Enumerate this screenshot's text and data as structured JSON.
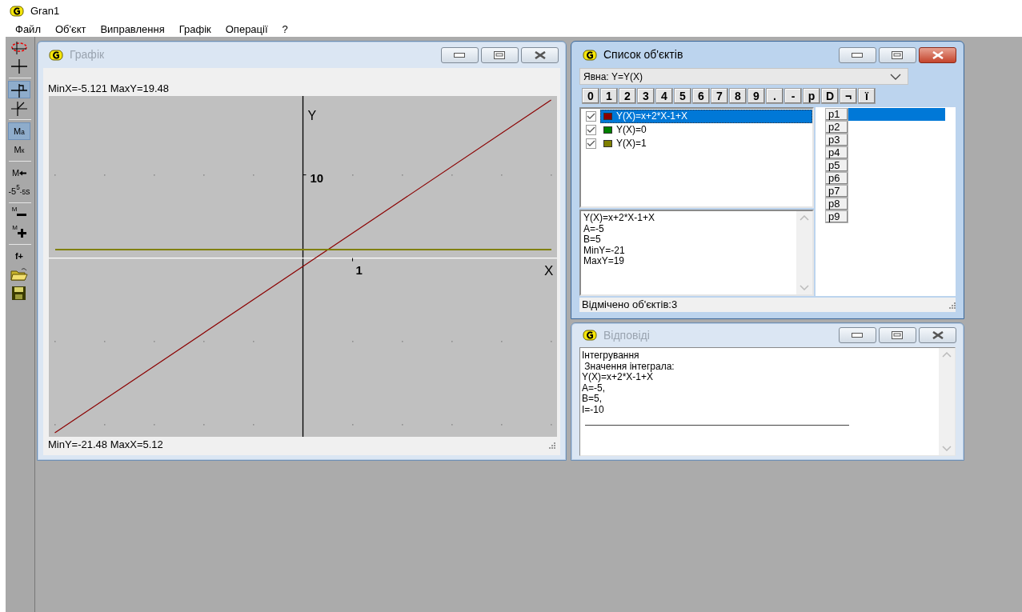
{
  "app": {
    "title": "Gran1"
  },
  "menu": [
    "Файл",
    "Об'єкт",
    "Виправлення",
    "Графік",
    "Операції",
    "?"
  ],
  "toolbar": [
    [
      {
        "kind": "ellipse-cross",
        "selected": false
      },
      {
        "kind": "cross",
        "selected": false
      }
    ],
    [
      {
        "kind": "cross-flag",
        "selected": true
      },
      {
        "kind": "cross-slant",
        "selected": false
      }
    ],
    [
      {
        "kind": "text",
        "label": "M$_{a}$",
        "selected": true
      },
      {
        "kind": "text",
        "label": "M$_{к}$",
        "selected": false
      }
    ],
    [
      {
        "kind": "text-arrow",
        "label": "M",
        "selected": false
      },
      {
        "kind": "text",
        "label": "-5$^{5}$$_{-5}$s",
        "selected": false
      }
    ],
    [
      {
        "kind": "text-minus",
        "label": "M",
        "selected": false
      },
      {
        "kind": "text-plus",
        "label": "M",
        "selected": false
      }
    ],
    [
      {
        "kind": "text",
        "label": "f+",
        "selected": false
      },
      {
        "kind": "folder",
        "selected": false
      },
      {
        "kind": "disk",
        "selected": false
      }
    ]
  ],
  "graph_window": {
    "title": "Графік",
    "active": false,
    "top_label": "MinX=-5.121  MaxY=19.48",
    "bottom_label": "MinY=-21.48  MaxX=5.12",
    "plot": {
      "x_axis_label": "X",
      "y_axis_label": "Y",
      "y_tick_label": "10",
      "x_tick_label": "1",
      "lines": [
        {
          "kind": "rising",
          "color": "#8b0000"
        },
        {
          "kind": "flat",
          "color": "#808000"
        }
      ]
    }
  },
  "objects_window": {
    "title": "Список об'єктів",
    "active": true,
    "type_select": "Явна: Y=Y(X)",
    "keys": [
      "0",
      "1",
      "2",
      "3",
      "4",
      "5",
      "6",
      "7",
      "8",
      "9",
      ".",
      "-",
      "p",
      "D",
      "¬",
      "ї"
    ],
    "objects": [
      {
        "text": "Y(X)=x+2*X-1+X",
        "checked": true,
        "color": "#8b0000",
        "selected": true
      },
      {
        "text": "Y(X)=0",
        "checked": true,
        "color": "#008000",
        "selected": false
      },
      {
        "text": "Y(X)=1",
        "checked": true,
        "color": "#808000",
        "selected": false
      }
    ],
    "details": [
      "Y(X)=x+2*X-1+X",
      "A=-5",
      "B=5",
      "MinY=-21",
      "MaxY=19"
    ],
    "params": [
      {
        "label": "p1",
        "selected": true
      },
      {
        "label": "p2",
        "selected": false
      },
      {
        "label": "p3",
        "selected": false
      },
      {
        "label": "p4",
        "selected": false
      },
      {
        "label": "p5",
        "selected": false
      },
      {
        "label": "p6",
        "selected": false
      },
      {
        "label": "p7",
        "selected": false
      },
      {
        "label": "p8",
        "selected": false
      },
      {
        "label": "p9",
        "selected": false
      }
    ],
    "status": "Відмічено об'єктів:3"
  },
  "answers_window": {
    "title": "Відповіді",
    "active": false,
    "lines": [
      "Інтегрування",
      " Значення інтеграла:",
      "Y(X)=x+2*X-1+X",
      "A=-5,",
      "B=5,",
      "I=-10"
    ]
  }
}
